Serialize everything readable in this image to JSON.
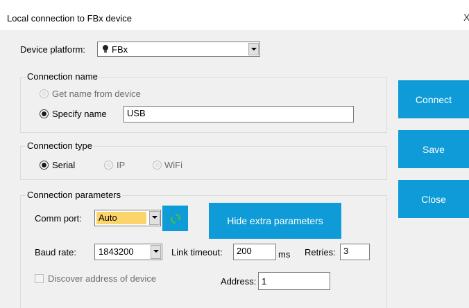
{
  "window": {
    "title": "Local connection to FBx device",
    "close_glyph": "X"
  },
  "device_platform": {
    "label": "Device platform:",
    "value": "FBx",
    "icon": "lightbulb-icon"
  },
  "connection_name": {
    "legend": "Connection name",
    "option_from_device": "Get name from device",
    "option_specify": "Specify name",
    "selected": "Specify name",
    "name_value": "USB"
  },
  "connection_type": {
    "legend": "Connection type",
    "options": [
      "Serial",
      "IP",
      "WiFi"
    ],
    "selected": "Serial"
  },
  "connection_parameters": {
    "legend": "Connection parameters",
    "comm_port_label": "Comm port:",
    "comm_port_value": "Auto",
    "refresh_icon": "refresh-icon",
    "hide_extra_label": "Hide extra parameters",
    "baud_rate_label": "Baud rate:",
    "baud_rate_value": "1843200",
    "link_timeout_label": "Link timeout:",
    "link_timeout_value": "200",
    "link_timeout_unit": "ms",
    "retries_label": "Retries:",
    "retries_value": "3",
    "discover_label": "Discover address of device",
    "address_label": "Address:",
    "address_value": "1"
  },
  "actions": {
    "connect": "Connect",
    "save": "Save",
    "close": "Close"
  },
  "colors": {
    "accent": "#0e9bd7",
    "combo_highlight": "#fbd56b"
  }
}
